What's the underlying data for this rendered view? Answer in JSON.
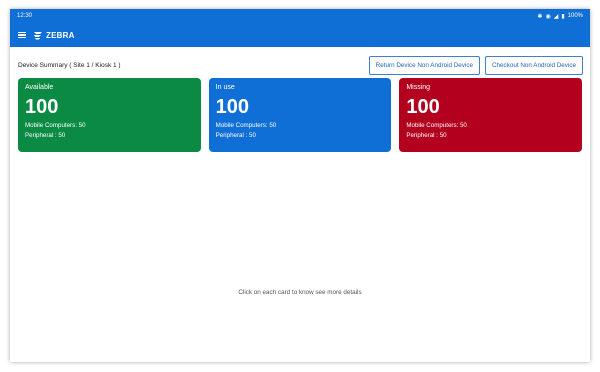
{
  "status": {
    "time": "12:30",
    "battery": "100%"
  },
  "appbar": {
    "brand": "ZEBRA"
  },
  "summary": {
    "title": "Device Summary ( Site 1 / Kiosk 1 )"
  },
  "actions": {
    "return_label": "Return Device Non Android Device",
    "checkout_label": "Checkout Non Android Device"
  },
  "cards": [
    {
      "label": "Available",
      "count": "100",
      "mobile": "Mobile Computers: 50",
      "peripheral": "Peripheral : 50",
      "color": "#0a8a43"
    },
    {
      "label": "In use",
      "count": "100",
      "mobile": "Mobile Computers: 50",
      "peripheral": "Peripheral : 50",
      "color": "#0f6fd6"
    },
    {
      "label": "Missing",
      "count": "100",
      "mobile": "Mobile Computers: 50",
      "peripheral": "Peripheral : 50",
      "color": "#b3001f"
    }
  ],
  "hint": "Click on each card to know see more details",
  "colors": {
    "primary": "#0f6fd6",
    "available": "#0a8a43",
    "missing": "#b3001f"
  }
}
